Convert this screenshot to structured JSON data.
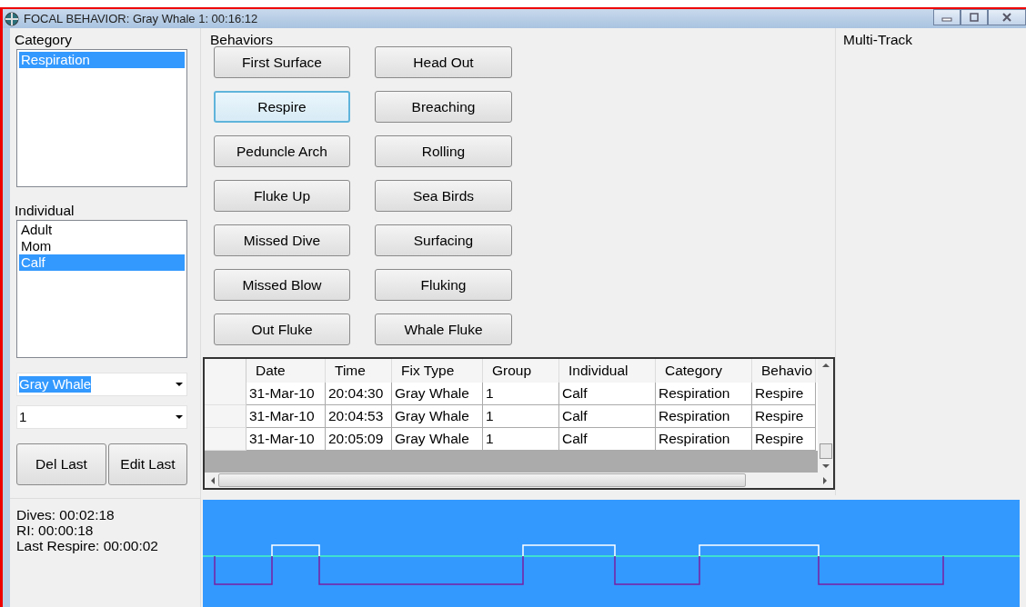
{
  "window": {
    "title": "FOCAL BEHAVIOR: Gray Whale 1:  00:16:12"
  },
  "category": {
    "label": "Category",
    "items": [
      {
        "label": "Respiration",
        "selected": true
      }
    ]
  },
  "individual": {
    "label": "Individual",
    "items": [
      {
        "label": "Adult",
        "selected": false
      },
      {
        "label": "Mom",
        "selected": false
      },
      {
        "label": "Calf",
        "selected": true
      }
    ]
  },
  "species_combo": {
    "value": "Gray Whale",
    "highlighted": true
  },
  "group_combo": {
    "value": "1",
    "highlighted": false
  },
  "actions": [
    "Del Last",
    "Edit Last"
  ],
  "stats": [
    "Dives: 00:02:18",
    "RI: 00:00:18",
    "Last Respire: 00:00:02"
  ],
  "behaviors": {
    "label": "Behaviors",
    "buttons": [
      {
        "label": "First Surface",
        "focused": false
      },
      {
        "label": "Head Out",
        "focused": false
      },
      {
        "label": "Respire",
        "focused": true
      },
      {
        "label": "Breaching",
        "focused": false
      },
      {
        "label": "Peduncle Arch",
        "focused": false
      },
      {
        "label": "Rolling",
        "focused": false
      },
      {
        "label": "Fluke Up",
        "focused": false
      },
      {
        "label": "Sea Birds",
        "focused": false
      },
      {
        "label": "Missed Dive",
        "focused": false
      },
      {
        "label": "Surfacing",
        "focused": false
      },
      {
        "label": "Missed Blow",
        "focused": false
      },
      {
        "label": "Fluking",
        "focused": false
      },
      {
        "label": "Out Fluke",
        "focused": false
      },
      {
        "label": "Whale Fluke",
        "focused": false
      }
    ]
  },
  "table": {
    "columns": [
      "Date",
      "Time",
      "Fix Type",
      "Group",
      "Individual",
      "Category",
      "Behavio"
    ],
    "rows": [
      [
        "31-Mar-10",
        "20:04:30",
        "Gray Whale",
        "1",
        "Calf",
        "Respiration",
        "Respire"
      ],
      [
        "31-Mar-10",
        "20:04:53",
        "Gray Whale",
        "1",
        "Calf",
        "Respiration",
        "Respire"
      ],
      [
        "31-Mar-10",
        "20:05:09",
        "Gray Whale",
        "1",
        "Calf",
        "Respiration",
        "Respire"
      ]
    ]
  },
  "multi_track": {
    "label": "Multi-Track"
  }
}
